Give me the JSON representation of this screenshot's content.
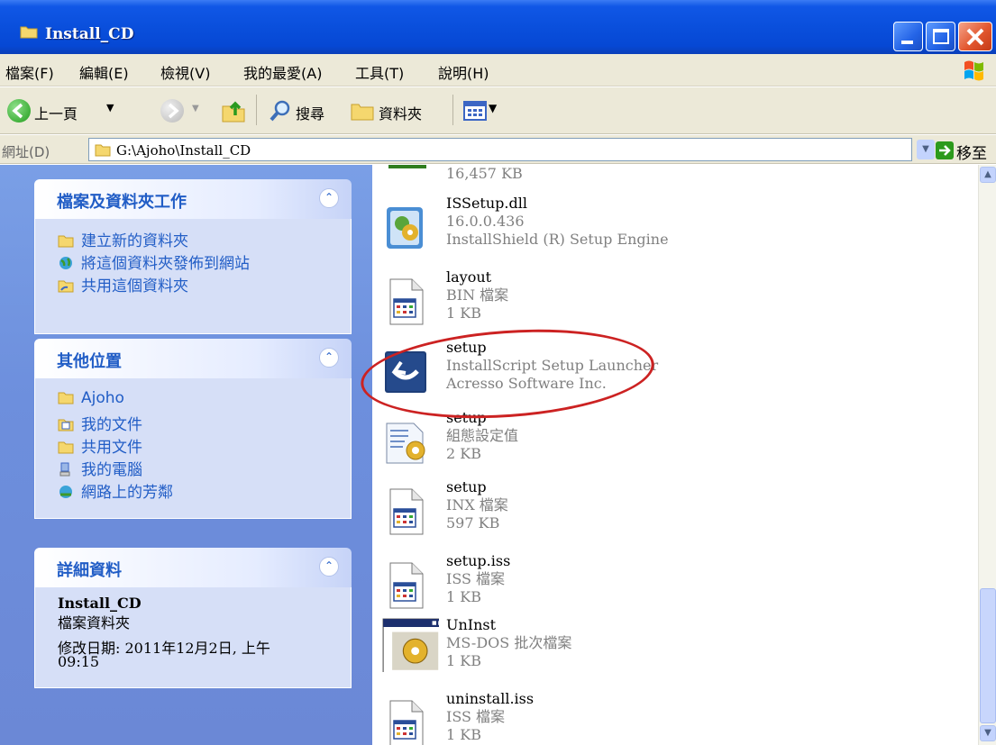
{
  "window": {
    "title": "Install_CD"
  },
  "menu": [
    "檔案(F)",
    "編輯(E)",
    "檢視(V)",
    "我的最愛(A)",
    "工具(T)",
    "說明(H)"
  ],
  "toolbar": {
    "back_label": "上一頁",
    "search_label": "搜尋",
    "folders_label": "資料夾"
  },
  "address": {
    "label": "網址(D)",
    "path": "G:\\Ajoho\\Install_CD",
    "go_label": "移至"
  },
  "tasks": {
    "title": "檔案及資料夾工作",
    "items": [
      "建立新的資料夾",
      "將這個資料夾發佈到網站",
      "共用這個資料夾"
    ]
  },
  "places": {
    "title": "其他位置",
    "items": [
      "Ajoho",
      "我的文件",
      "共用文件",
      "我的電腦",
      "網路上的芳鄰"
    ]
  },
  "details": {
    "title": "詳細資料",
    "name": "Install_CD",
    "type": "檔案資料夾",
    "modified": "修改日期: 2011年12月2日, 上午",
    "time": "09:15"
  },
  "files": [
    {
      "name": "",
      "line2": "16,457 KB",
      "line3": "",
      "icon": "installer-icon"
    },
    {
      "name": "ISSetup.dll",
      "line2": "16.0.0.436",
      "line3": "InstallShield (R) Setup Engine",
      "icon": "dll-icon"
    },
    {
      "name": "layout",
      "line2": "BIN 檔案",
      "line3": "1 KB",
      "icon": "generic-file-icon"
    },
    {
      "name": "setup",
      "line2": "InstallScript Setup Launcher",
      "line3": "Acresso Software Inc.",
      "icon": "setup-launcher-icon"
    },
    {
      "name": "setup",
      "line2": "組態設定值",
      "line3": "2 KB",
      "icon": "config-file-icon"
    },
    {
      "name": "setup",
      "line2": "INX 檔案",
      "line3": "597 KB",
      "icon": "generic-file-icon"
    },
    {
      "name": "setup.iss",
      "line2": "ISS 檔案",
      "line3": "1 KB",
      "icon": "generic-file-icon"
    },
    {
      "name": "UnInst",
      "line2": "MS-DOS 批次檔案",
      "line3": "1 KB",
      "icon": "batch-file-icon"
    },
    {
      "name": "uninstall.iss",
      "line2": "ISS 檔案",
      "line3": "1 KB",
      "icon": "generic-file-icon"
    }
  ],
  "colors": {
    "titlebar": "#0a4fdc",
    "taskpane": "#6d8fdd",
    "link": "#215dc6",
    "highlight_circle": "#cc2222"
  }
}
